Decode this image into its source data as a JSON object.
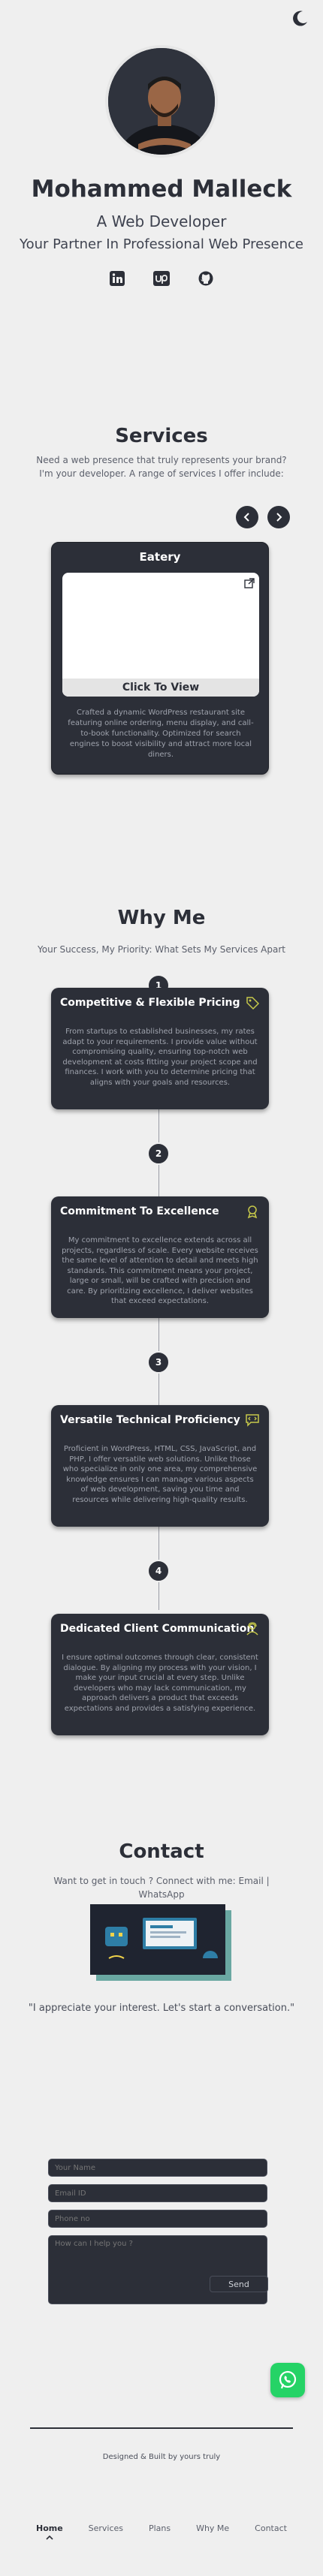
{
  "theme": {
    "bg": "#efefef",
    "card": "#2c2f38",
    "accent": "#c7c94a",
    "whatsapp": "#25d366"
  },
  "header": {
    "theme_toggle_icon": "moon-icon"
  },
  "hero": {
    "name": "Mohammed Malleck",
    "role": "A Web Developer",
    "tagline": "Your Partner In Professional Web Presence",
    "socials": [
      {
        "icon": "linkedin-icon"
      },
      {
        "icon": "upwork-icon"
      },
      {
        "icon": "github-icon"
      }
    ]
  },
  "services": {
    "title": "Services",
    "subtitle": "Need a web presence that truly represents your brand? I'm your developer. A range of services I offer include:",
    "prev_icon": "chevron-left-icon",
    "next_icon": "chevron-right-icon",
    "project": {
      "title": "Eatery",
      "cta": "Click To View",
      "description": "Crafted a dynamic WordPress restaurant site featuring online ordering, menu display, and call-to-book functionality. Optimized for search engines to boost visibility and attract more local diners."
    }
  },
  "why_me": {
    "title": "Why Me",
    "subtitle": "Your Success, My Priority: What Sets My Services Apart",
    "reasons": [
      {
        "step": "1",
        "title": "Competitive & Flexible Pricing",
        "icon": "price-tag-icon",
        "text": "From startups to established businesses, my rates adapt to your requirements. I provide value without compromising quality, ensuring top-notch web development at costs fitting your project scope and finances. I work with you to determine pricing that aligns with your goals and resources."
      },
      {
        "step": "2",
        "title": "Commitment To Excellence",
        "icon": "medal-icon",
        "text": "My commitment to excellence extends across all projects, regardless of scale. Every website receives the same level of attention to detail and meets high standards. This commitment means your project, large or small, will be crafted with precision and care. By prioritizing excellence, I deliver websites that exceed expectations."
      },
      {
        "step": "3",
        "title": "Versatile Technical Proficiency",
        "icon": "code-chat-icon",
        "text": "Proficient in WordPress, HTML, CSS, JavaScript, and PHP, I offer versatile web solutions. Unlike those who specialize in only one area, my comprehensive knowledge ensures I can manage various aspects of web development, saving you time and resources while delivering high-quality results."
      },
      {
        "step": "4",
        "title": "Dedicated Client Communication",
        "icon": "support-person-icon",
        "text": "I ensure optimal outcomes through clear, consistent dialogue. By aligning my process with your vision, I make your input crucial at every step. Unlike developers who may lack communication, my approach delivers a product that exceeds expectations and provides a satisfying experience."
      }
    ]
  },
  "contact": {
    "title": "Contact",
    "subtitle": "Want to get in touch ? Connect with me: Email | WhatsApp",
    "quote": "\"I appreciate your interest. Let's start a conversation.\"",
    "name_placeholder": "Your Name",
    "email_placeholder": "Email ID",
    "phone_placeholder": "Phone no",
    "message_placeholder": "How can I help you ?",
    "send_label": "Send"
  },
  "whatsapp": {
    "icon": "whatsapp-icon"
  },
  "footer": {
    "credit": "Designed & Built by yours truly"
  },
  "bottom_nav": {
    "items": [
      {
        "label": "Home",
        "active": true
      },
      {
        "label": "Services"
      },
      {
        "label": "Plans"
      },
      {
        "label": "Why Me"
      },
      {
        "label": "Contact"
      }
    ]
  }
}
